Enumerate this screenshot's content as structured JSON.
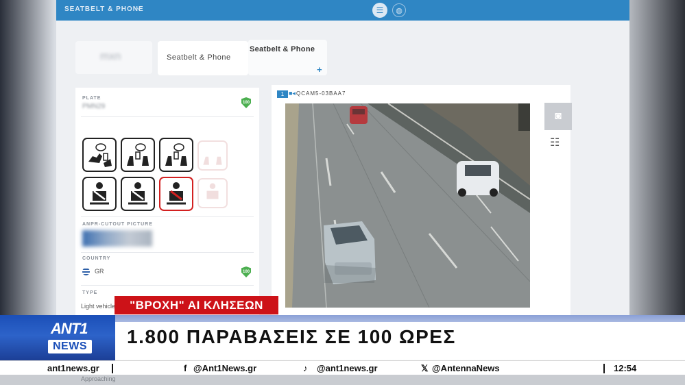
{
  "app": {
    "breadcrumb": "SEATBELT & PHONE",
    "tab_active": "Seatbelt & Phone",
    "tab_open": "Seatbelt & Phone",
    "blurred_card_text": "mxn"
  },
  "left_panel": {
    "plate_label": "PLATE",
    "plate_value": "PMN29",
    "plate_score": "100",
    "anpr_label": "ANPR-CUTOUT PICTURE",
    "country_label": "COUNTRY",
    "country_value": "GR",
    "country_score": "100",
    "type_label": "TYPE",
    "type_value": "Light vehicle"
  },
  "camera": {
    "index": "1",
    "name": "QCAM5-03BAA7",
    "snapshot_icon": "camera-icon",
    "settings_icon": "sliders-icon"
  },
  "news": {
    "label": "\"ΒΡΟΧΗ\" ΑΙ ΚΛΗΣΕΩΝ",
    "headline": "1.800 ΠΑΡΑΒΑΣΕΙΣ ΣΕ 100 ΩΡΕΣ",
    "logo_top": "ANT1",
    "logo_bottom": "NEWS",
    "ticker": {
      "site": "ant1news.gr",
      "facebook": "@Ant1News.gr",
      "tiktok": "@ant1news.gr",
      "x": "@AntennaNews",
      "time": "12:54"
    },
    "under_text": "Approaching"
  },
  "colors": {
    "topbar": "#2f86c4",
    "violation_red": "#d32020",
    "label_red": "#cd1218",
    "logo_blue": "#1b4fb8"
  }
}
